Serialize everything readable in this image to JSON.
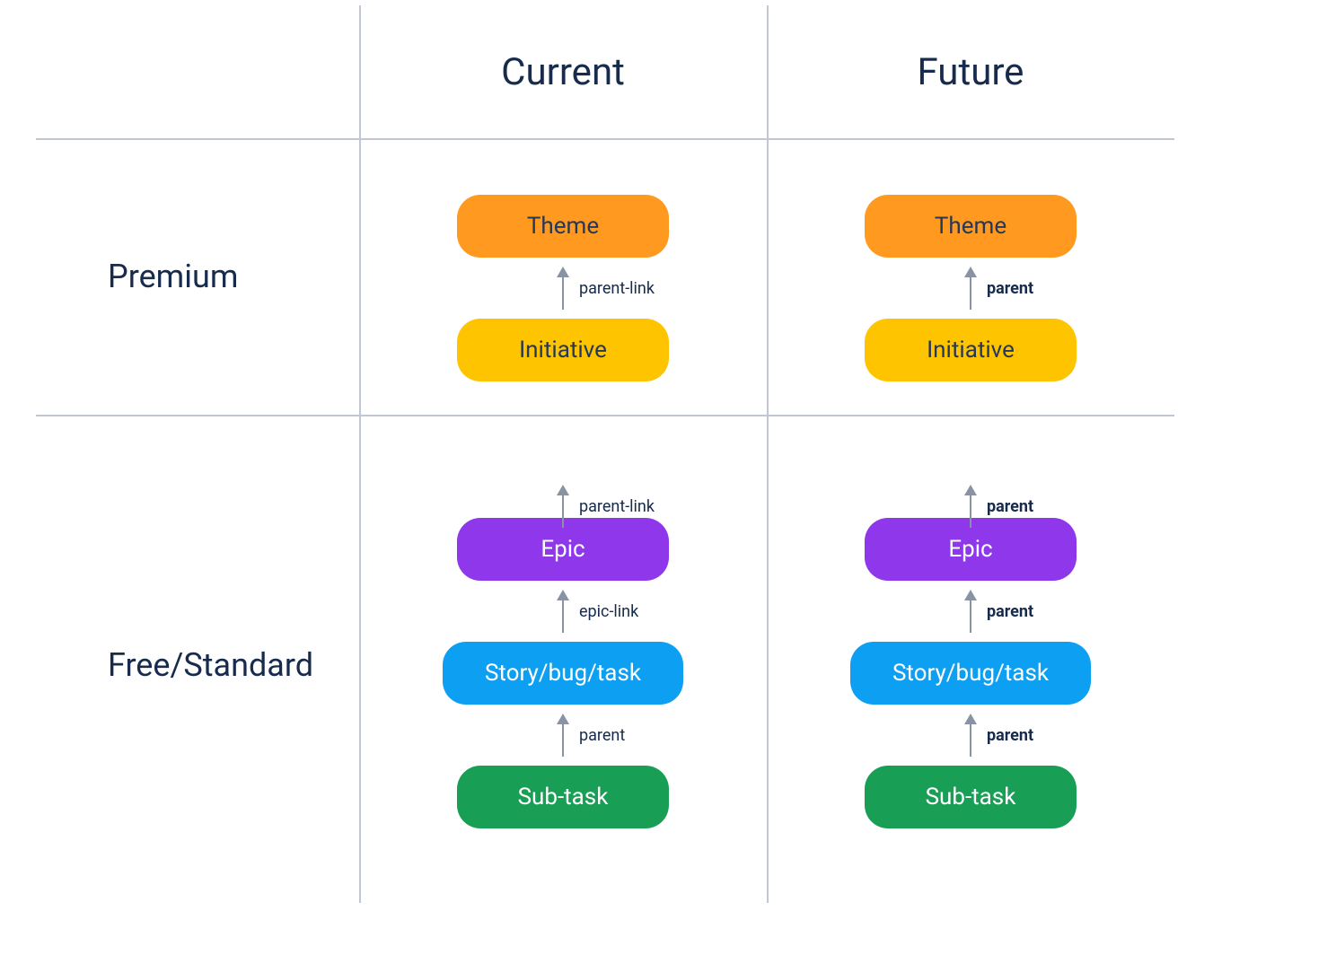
{
  "headers": {
    "col1": "Current",
    "col2": "Future",
    "row1": "Premium",
    "row2": "Free/Standard"
  },
  "colors": {
    "theme": "#FF991F",
    "initiative": "#FFC400",
    "epic": "#8F37EB",
    "story": "#0C9FF2",
    "subtask": "#189F55",
    "gridline": "#c1c7d0",
    "arrow": "#8993A4",
    "text_dark": "#172B4D"
  },
  "nodes": {
    "theme": "Theme",
    "initiative": "Initiative",
    "epic": "Epic",
    "story": "Story/bug/task",
    "subtask": "Sub-task"
  },
  "links": {
    "current": {
      "initiative_to_theme": "parent-link",
      "epic_to_initiative": "parent-link",
      "story_to_epic": "epic-link",
      "subtask_to_story": "parent"
    },
    "future": {
      "initiative_to_theme": "parent",
      "epic_to_initiative": "parent",
      "story_to_epic": "parent",
      "subtask_to_story": "parent"
    }
  }
}
